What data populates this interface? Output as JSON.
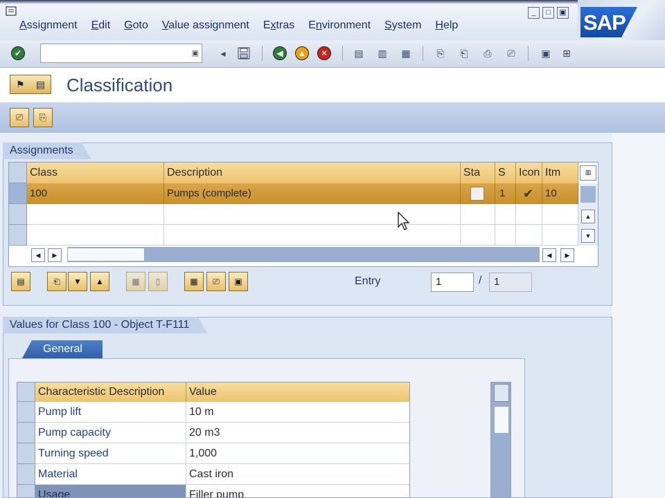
{
  "menu": {
    "items": [
      {
        "label": "Assignment",
        "underline_index": 0
      },
      {
        "label": "Edit",
        "underline_index": 0
      },
      {
        "label": "Goto",
        "underline_index": 0
      },
      {
        "label": "Value assignment",
        "underline_index": 0
      },
      {
        "label": "Extras",
        "underline_index": 1
      },
      {
        "label": "Environment",
        "underline_index": 1
      },
      {
        "label": "System",
        "underline_index": 0
      },
      {
        "label": "Help",
        "underline_index": 0
      }
    ]
  },
  "window_buttons": [
    "minimize",
    "maximize",
    "close"
  ],
  "brand": {
    "logo_text": "SAP",
    "color": "#1a5bbf"
  },
  "toolbar": {
    "command_field_value": "",
    "icons": [
      "enter-icon",
      "back-arrow-icon",
      "save-icon",
      "back-icon",
      "exit-icon",
      "cancel-icon",
      "print-icon",
      "find-icon",
      "find-next-icon",
      "first-page-icon",
      "previous-page-icon",
      "next-page-icon",
      "last-page-icon",
      "create-session-icon",
      "shortcut-icon"
    ]
  },
  "page": {
    "title": "Classification"
  },
  "assignments": {
    "section_title": "Assignments",
    "columns": [
      "Class",
      "Description",
      "Sta",
      "S",
      "Icon",
      "Itm"
    ],
    "rows": [
      {
        "class": "100",
        "description": "Pumps (complete)",
        "status": "",
        "s": "1",
        "icon": "✔",
        "item": "10",
        "selected": true
      }
    ]
  },
  "entry": {
    "label": "Entry",
    "current": "1",
    "separator": "/",
    "total": "1"
  },
  "values": {
    "section_title": "Values for Class 100 - Object T-F111",
    "active_tab": "General",
    "columns": [
      "Characteristic Description",
      "Value"
    ],
    "rows": [
      {
        "description": "Pump lift",
        "value": "10 m"
      },
      {
        "description": "Pump capacity",
        "value": "20 m3"
      },
      {
        "description": "Turning speed",
        "value": "1,000"
      },
      {
        "description": "Material",
        "value": "Cast iron"
      },
      {
        "description": "Usage",
        "value": "Filler pump"
      }
    ]
  }
}
